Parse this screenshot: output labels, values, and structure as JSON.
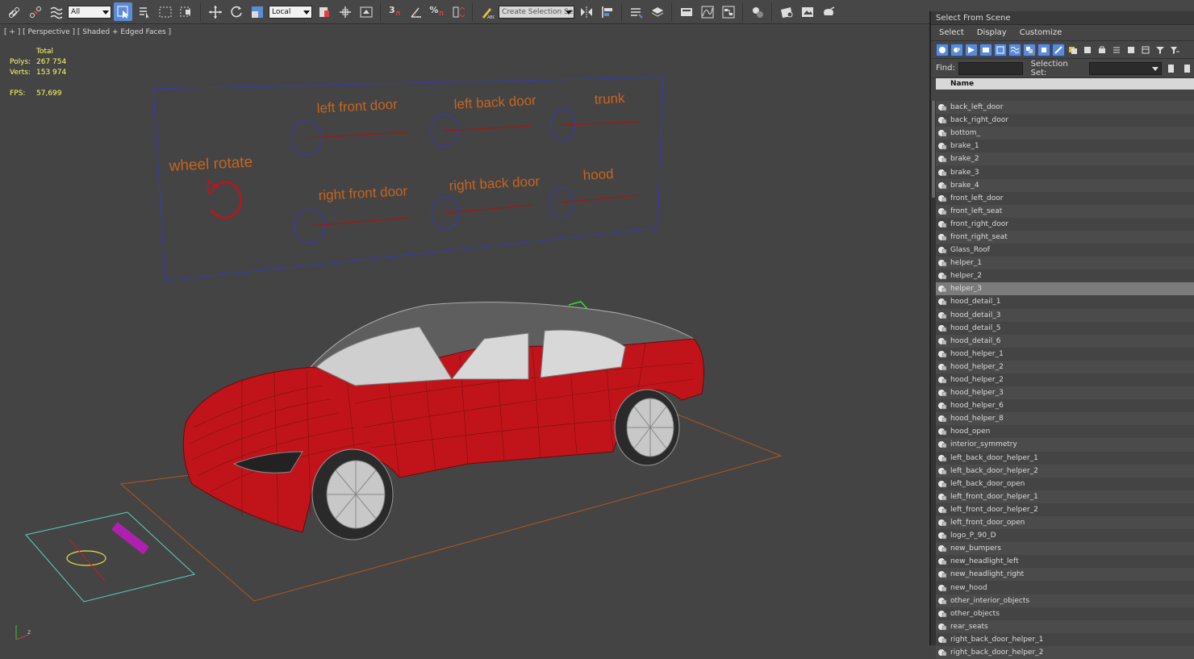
{
  "toolbar": {
    "selection_filter": "All",
    "coord_system": "Local",
    "named_selection_placeholder": "Create Selection Se",
    "snap_labels": [
      "3",
      "%"
    ]
  },
  "viewport": {
    "label": "[ + ] [ Perspective ] [ Shaded + Edged Faces ]",
    "stats": {
      "header": "Total",
      "polys_label": "Polys:",
      "polys_value": "267 754",
      "verts_label": "Verts:",
      "verts_value": "153 974",
      "fps_label": "FPS:",
      "fps_value": "57,699"
    },
    "rig_labels": {
      "wheel_rotate": "wheel rotate",
      "left_front_door": "left front door",
      "left_back_door": "left back door",
      "trunk": "trunk",
      "right_front_door": "right front door",
      "right_back_door": "right back door",
      "hood": "hood"
    }
  },
  "panel": {
    "title": "Select From Scene",
    "menu": [
      "Select",
      "Display",
      "Customize"
    ],
    "find_label": "Find:",
    "selection_set_label": "Selection Set:",
    "column_header": "Name",
    "selected_index": 14,
    "items": [
      "back_left_door",
      "back_right_door",
      "bottom_",
      "brake_1",
      "brake_2",
      "brake_3",
      "brake_4",
      "front_left_door",
      "front_left_seat",
      "front_right_door",
      "front_right_seat",
      "Glass_Roof",
      "helper_1",
      "helper_2",
      "helper_3",
      "hood_detail_1",
      "hood_detail_3",
      "hood_detail_5",
      "hood_detail_6",
      "hood_helper_1",
      "hood_helper_2",
      "hood_helper_2",
      "hood_helper_3",
      "hood_helper_6",
      "hood_helper_8",
      "hood_open",
      "interior_symmetry",
      "left_back_door_helper_1",
      "left_back_door_helper_2",
      "left_back_door_open",
      "left_front_door_helper_1",
      "left_front_door_helper_2",
      "left_front_door_open",
      "logo_P_90_D",
      "new_bumpers",
      "new_headlight_left",
      "new_headlight_right",
      "new_hood",
      "other_interior_objects",
      "other_objects",
      "rear_seats",
      "right_back_door_helper_1",
      "right_back_door_helper_2"
    ]
  },
  "colors": {
    "accent": "#5b8bd8",
    "car_red": "#c0141a",
    "wire_grey": "#8a8a8a",
    "rig_blue": "#3a3aa8",
    "rig_label": "#c8641e",
    "stats_yellow": "#ffff66"
  }
}
